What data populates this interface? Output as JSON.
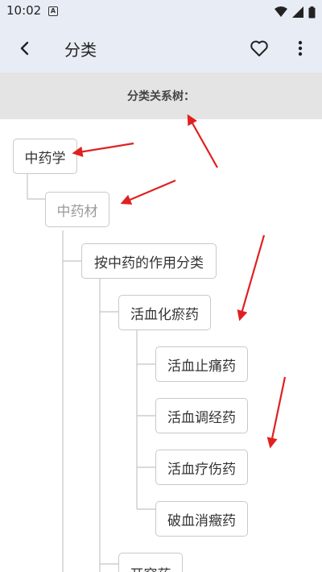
{
  "status_bar": {
    "time": "10:02",
    "notification_icon": "a-badge-icon",
    "icons": [
      "wifi-icon",
      "signal-icon",
      "battery-icon"
    ]
  },
  "app_bar": {
    "title": "分类",
    "back_icon": "back-arrow-icon",
    "favorite_icon": "heart-outline-icon",
    "more_icon": "more-vert-icon"
  },
  "section": {
    "header": "分类关系树："
  },
  "tree": {
    "root": "中药学",
    "level1": "中药材",
    "level2": "按中药的作用分类",
    "level3": "活血化瘀药",
    "level4": [
      "活血止痛药",
      "活血调经药",
      "活血疗伤药",
      "破血消癥药"
    ],
    "level3_next": "开窍药"
  },
  "colors": {
    "bar_background": "#e8edf5",
    "section_background": "#e4e4e4",
    "node_border": "#c9c9c9",
    "arrow": "#e02020"
  }
}
